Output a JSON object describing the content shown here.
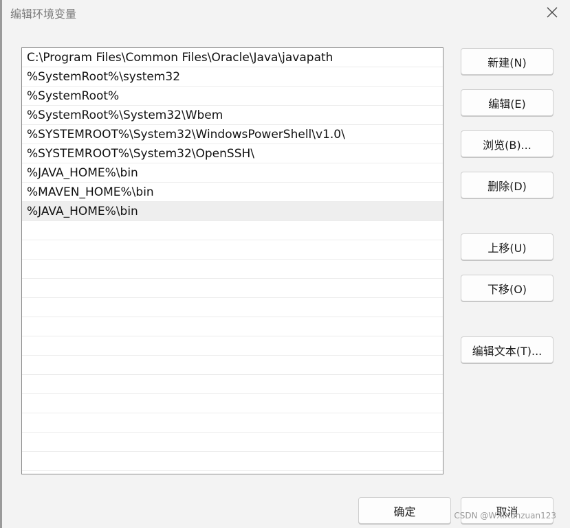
{
  "window": {
    "title": "编辑环境变量",
    "close_icon": "close-icon"
  },
  "paths": [
    "C:\\Program Files\\Common Files\\Oracle\\Java\\javapath",
    "%SystemRoot%\\system32",
    "%SystemRoot%",
    "%SystemRoot%\\System32\\Wbem",
    "%SYSTEMROOT%\\System32\\WindowsPowerShell\\v1.0\\",
    "%SYSTEMROOT%\\System32\\OpenSSH\\",
    "%JAVA_HOME%\\bin",
    "%MAVEN_HOME%\\bin",
    "%JAVA_HOME%\\bin"
  ],
  "selected_index": 8,
  "empty_row_count": 13,
  "buttons": {
    "new": "新建(N)",
    "edit": "编辑(E)",
    "browse": "浏览(B)...",
    "delete": "删除(D)",
    "move_up": "上移(U)",
    "move_down": "下移(O)",
    "edit_text": "编辑文本(T)..."
  },
  "footer": {
    "ok": "确定",
    "cancel": "取消"
  },
  "watermark": "CSDN @WXiXunzuan123"
}
